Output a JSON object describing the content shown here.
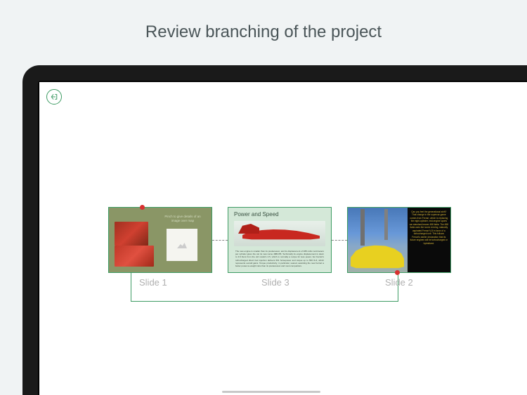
{
  "page": {
    "title": "Review branching of the project"
  },
  "toolbar": {
    "exit_label": "Exit"
  },
  "slides": {
    "slide1": {
      "label": "Slide 1",
      "caption": "Pinch to give details of an image over map"
    },
    "slide3": {
      "label": "Slide 3",
      "title": "Power and Speed",
      "body": "The new engine is smaller than its predecessor, and its displacement of 488 cubic centimeters per cylinder gives the car its new name 488GTB. Technically its engine displacement is down to 3.9 liters from the old model's 4.5, which is normally a recipe for less power, but Ferrari's turbocharged direct fuel injection delivers 661 horsepower and torque up to 560 lb-ft, which represents overall gains. Torque productivity, in particular, soared, awarding the new Ferrari a better power-to-weight ratio than its predecessor and most competitors."
    },
    "slide2": {
      "label": "Slide 2",
      "body": "Can you feel the generational shift? That change in the supercar game comes from Ferrari, which is replacing the eight-cylinder, mid-engine sports car standard-bearer 458 Italia. The 458 Italia uses the iconic revving, naturally aspirated Ferrari V-8 in favor of a turbocharged unit. This follows Ferrari's earlier declaration that its future engines will be turbocharged or hybridized."
    }
  },
  "colors": {
    "accent": "#3d9b63",
    "marker": "#d83030"
  }
}
